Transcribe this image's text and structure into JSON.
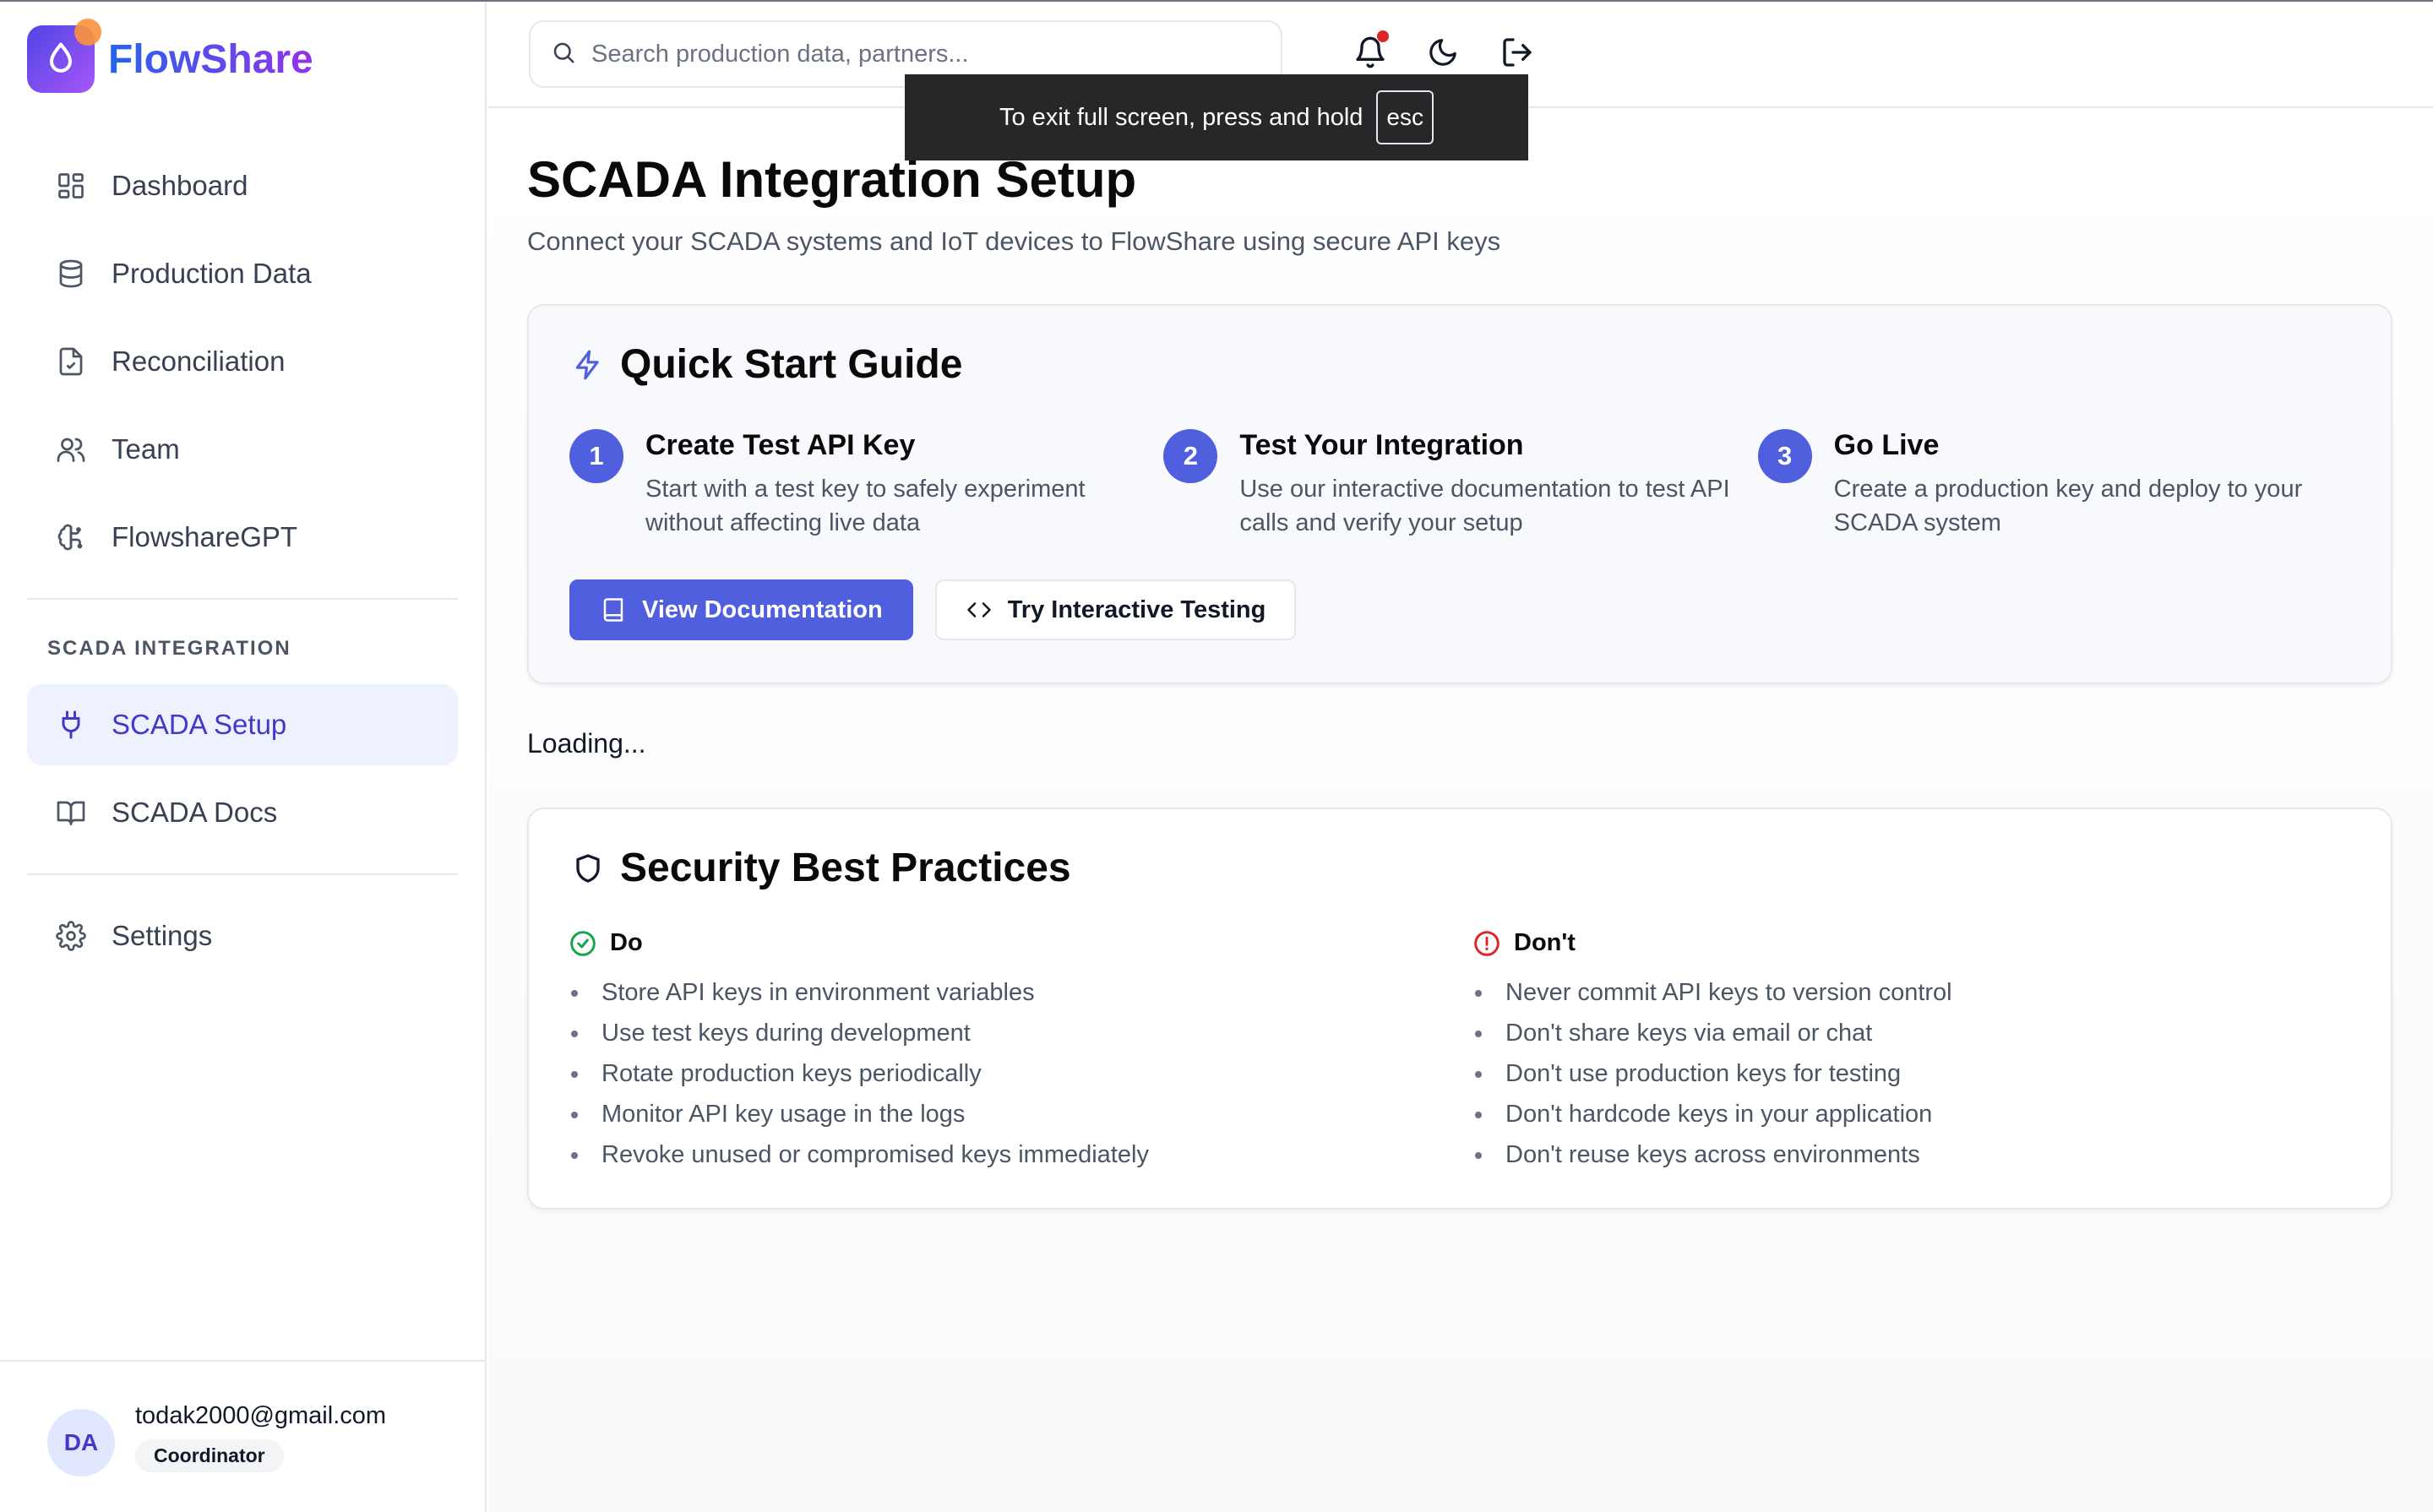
{
  "app": {
    "name": "FlowShare"
  },
  "sidebar": {
    "items": [
      {
        "label": "Dashboard",
        "icon": "dashboard-icon"
      },
      {
        "label": "Production Data",
        "icon": "database-icon"
      },
      {
        "label": "Reconciliation",
        "icon": "file-check-icon"
      },
      {
        "label": "Team",
        "icon": "users-icon"
      },
      {
        "label": "FlowshareGPT",
        "icon": "brain-icon"
      }
    ],
    "section_label": "SCADA INTEGRATION",
    "scada_items": [
      {
        "label": "SCADA Setup",
        "icon": "plug-icon",
        "active": true
      },
      {
        "label": "SCADA Docs",
        "icon": "book-open-icon"
      }
    ],
    "settings_label": "Settings",
    "user": {
      "initials": "DA",
      "email": "todak2000@gmail.com",
      "role": "Coordinator"
    }
  },
  "header": {
    "search_placeholder": "Search production data, partners...",
    "notification_badge_color": "#dc2626"
  },
  "toast": {
    "text": "To exit full screen, press and hold",
    "key": "esc"
  },
  "page": {
    "title": "SCADA Integration Setup",
    "subtitle": "Connect your SCADA systems and IoT devices to FlowShare using secure API keys"
  },
  "quick_start": {
    "title": "Quick Start Guide",
    "steps": [
      {
        "num": "1",
        "title": "Create Test API Key",
        "desc": "Start with a test key to safely experiment without affecting live data"
      },
      {
        "num": "2",
        "title": "Test Your Integration",
        "desc": "Use our interactive documentation to test API calls and verify your setup"
      },
      {
        "num": "3",
        "title": "Go Live",
        "desc": "Create a production key and deploy to your SCADA system"
      }
    ],
    "primary_button": "View Documentation",
    "secondary_button": "Try Interactive Testing"
  },
  "loading_text": "Loading...",
  "security": {
    "title": "Security Best Practices",
    "do": {
      "heading": "Do",
      "items": [
        "Store API keys in environment variables",
        "Use test keys during development",
        "Rotate production keys periodically",
        "Monitor API key usage in the logs",
        "Revoke unused or compromised keys immediately"
      ]
    },
    "dont": {
      "heading": "Don't",
      "items": [
        "Never commit API keys to version control",
        "Don't share keys via email or chat",
        "Don't use production keys for testing",
        "Don't hardcode keys in your application",
        "Don't reuse keys across environments"
      ]
    }
  },
  "colors": {
    "accent": "#4f5fde",
    "success": "#16a34a",
    "danger": "#dc2626"
  }
}
